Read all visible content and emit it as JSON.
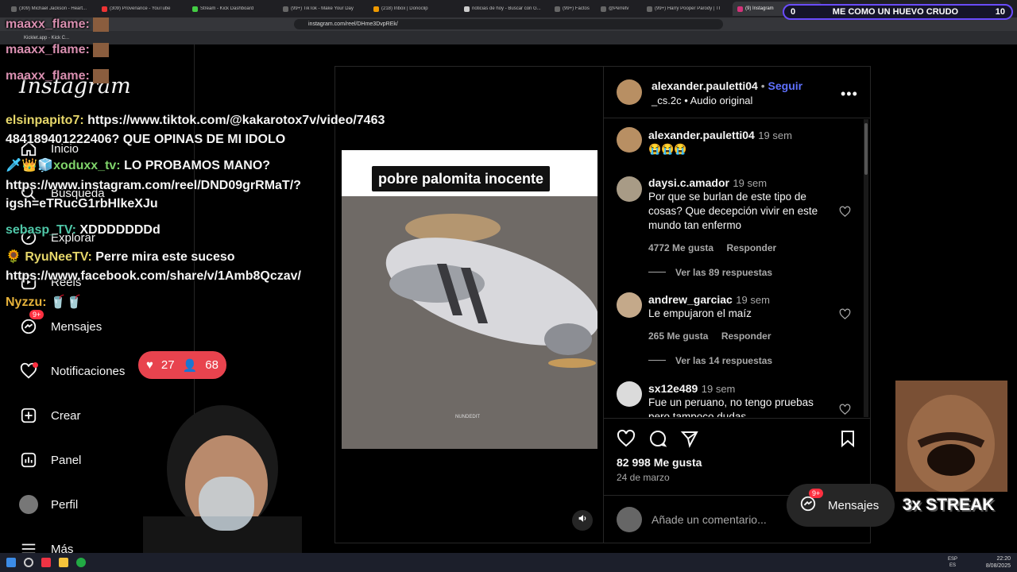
{
  "browser": {
    "tabs": [
      "(309) Michael Jackson - Heart...",
      "(309) Provenance - YouTube",
      "Stream - Kick Dashboard",
      "(99+) TikTok - Make Your Day",
      "(218) Inbox | Donoclip",
      "noticias de hoy - Buscar con G...",
      "(99+) Factos",
      "@Perretv",
      "(99+) Harry Pooper Parody | TI",
      "(9) Instagram"
    ],
    "url": "instagram.com/reel/DHme3DvpREk/",
    "bookmark": "Kicklet.app - Kick C..."
  },
  "instagram": {
    "logo": "Instagram",
    "nav": [
      {
        "label": "Inicio",
        "icon": "home-icon"
      },
      {
        "label": "Búsqueda",
        "icon": "search-icon"
      },
      {
        "label": "Explorar",
        "icon": "explore-icon"
      },
      {
        "label": "Reels",
        "icon": "reels-icon"
      },
      {
        "label": "Mensajes",
        "icon": "messages-icon",
        "badge": "9+"
      },
      {
        "label": "Notificaciones",
        "icon": "heart-icon"
      },
      {
        "label": "Crear",
        "icon": "plus-square-icon"
      },
      {
        "label": "Panel",
        "icon": "chart-icon"
      },
      {
        "label": "Perfil",
        "icon": "avatar-icon"
      },
      {
        "label": "Más",
        "icon": "menu-icon"
      }
    ]
  },
  "post": {
    "caption_overlay": "pobre palomita inocente",
    "watermark": "NUNDEDIT",
    "author": "alexander.pauletti04",
    "follow": "Seguir",
    "audio_user": "_cs.2c",
    "audio": "Audio original",
    "author_comment_time": "19 sem",
    "author_comment_emojis": "😭😭😭",
    "likes": "82 998 Me gusta",
    "date": "24 de marzo",
    "comment_placeholder": "Añade un comentario...",
    "comments": [
      {
        "user": "daysi.c.amador",
        "time": "19 sem",
        "text": "Por que se burlan de este tipo de cosas? Que decepción vivir en este mundo tan enfermo",
        "likes": "4772 Me gusta",
        "reply": "Responder",
        "replies": "Ver las 89 respuestas"
      },
      {
        "user": "andrew_garciac",
        "time": "19 sem",
        "text": "Le empujaron el maíz",
        "likes": "265 Me gusta",
        "reply": "Responder",
        "replies": "Ver las 14 respuestas"
      },
      {
        "user": "sx12e489",
        "time": "19 sem",
        "text": "Fue un peruano, no tengo pruebas pero tampoco dudas",
        "likes": "",
        "reply": "",
        "replies": ""
      }
    ]
  },
  "chat": [
    {
      "user": "maaxx_flame:",
      "text": "",
      "color": "#d98fb0"
    },
    {
      "user": "maaxx_flame:",
      "text": "",
      "color": "#d98fb0"
    },
    {
      "user": "maaxx_flame:",
      "text": "",
      "color": "#d98fb0"
    },
    {
      "user": "elsinpapito7:",
      "text": "https://www.tiktok.com/@kakarotox7v/video/7463",
      "color": "#e6d76a"
    },
    {
      "user": "",
      "text": "484189401222406? QUE OPINAS DE MI IDOLO",
      "color": "#ffffff"
    },
    {
      "user": "xoduxx_tv:",
      "text": "LO PROBAMOS MANO?",
      "color": "#7fd36a"
    },
    {
      "user": "",
      "text": "https://www.instagram.com/reel/DND09grRMaT/?",
      "color": "#ffffff"
    },
    {
      "user": "",
      "text": "igsh=eTRucG1rbHlkeXJu",
      "color": "#ffffff"
    },
    {
      "user": "sebasp_TV:",
      "text": "XDDDDDDDd",
      "color": "#4fc7a8"
    },
    {
      "user": "RyuNeeTV:",
      "text": "Perre mira este suceso",
      "color": "#e6d76a"
    },
    {
      "user": "",
      "text": "https://www.facebook.com/share/v/1Amb8Qczav/",
      "color": "#ffffff"
    },
    {
      "user": "Nyzzu:",
      "text": "🥤🥤",
      "color": "#e6b23a"
    }
  ],
  "overlay": {
    "likes_count": "27",
    "viewers_count": "68",
    "topbar_left": "0",
    "topbar_title": "ME COMO UN HUEVO CRUDO",
    "topbar_right": "10",
    "msg_badge": "9+",
    "msg_label": "Mensajes",
    "streak": "3x STREAK"
  },
  "taskbar": {
    "lang": "ESP",
    "lang2": "ES",
    "time": "22:20",
    "date": "8/08/2025"
  }
}
